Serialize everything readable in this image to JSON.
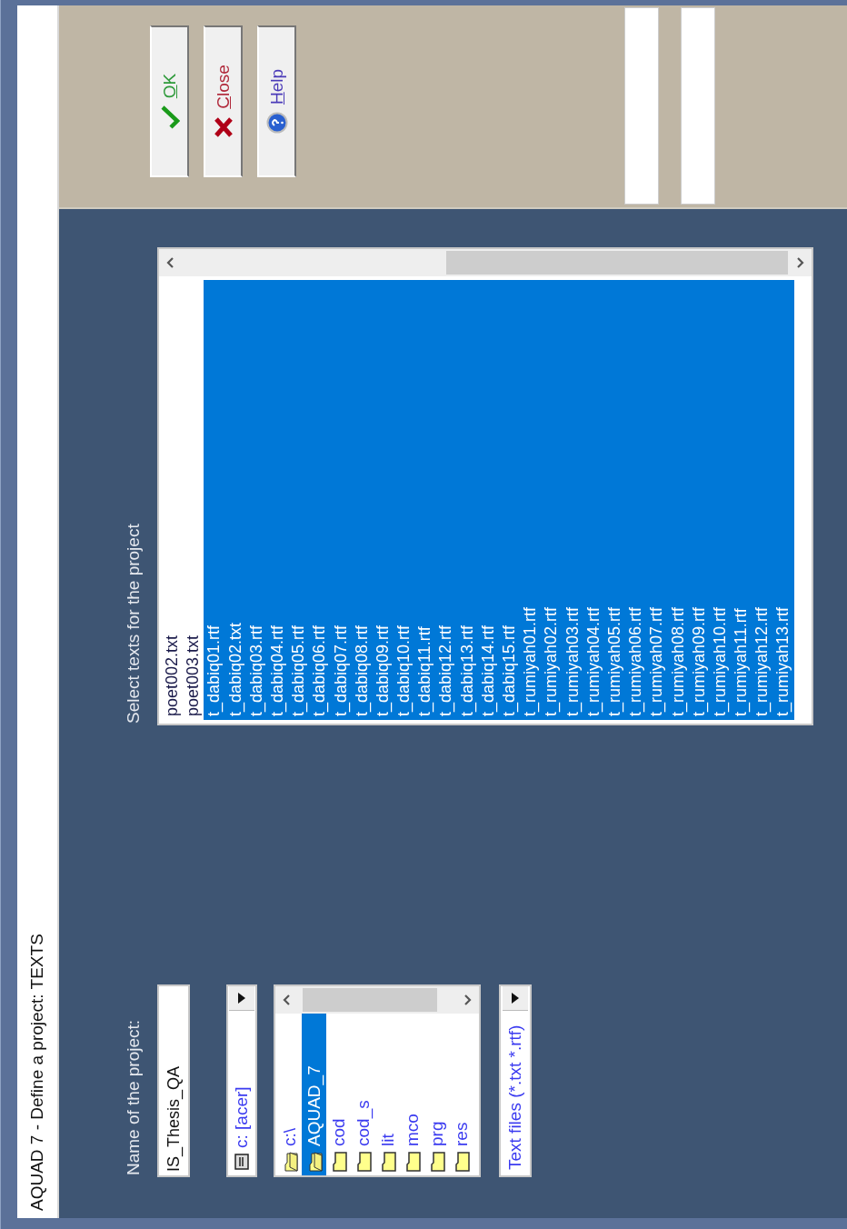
{
  "window": {
    "title": "AQUAD 7 - Define a project: TEXTS"
  },
  "project_name": {
    "label": "Name of the project:",
    "value": "IS_Thesis_QA"
  },
  "drive": {
    "value": "c: [acer]"
  },
  "folders": [
    {
      "name": "c:\\",
      "kind": "open",
      "selected": false
    },
    {
      "name": "AQUAD_7",
      "kind": "open",
      "selected": true
    },
    {
      "name": "cod",
      "kind": "closed",
      "selected": false
    },
    {
      "name": "cod_s",
      "kind": "closed",
      "selected": false
    },
    {
      "name": "lit",
      "kind": "closed",
      "selected": false
    },
    {
      "name": "mco",
      "kind": "closed",
      "selected": false
    },
    {
      "name": "prg",
      "kind": "closed",
      "selected": false
    },
    {
      "name": "res",
      "kind": "closed",
      "selected": false
    }
  ],
  "filter": {
    "value": "Text files (*.txt  *.rtf)"
  },
  "texts": {
    "label": "Select texts for the project",
    "items": [
      {
        "name": "poet002.txt",
        "selected": false
      },
      {
        "name": "poet003.txt",
        "selected": false
      },
      {
        "name": "t_dabiq01.rtf",
        "selected": true
      },
      {
        "name": "t_dabiq02.txt",
        "selected": true
      },
      {
        "name": "t_dabiq03.rtf",
        "selected": true
      },
      {
        "name": "t_dabiq04.rtf",
        "selected": true
      },
      {
        "name": "t_dabiq05.rtf",
        "selected": true
      },
      {
        "name": "t_dabiq06.rtf",
        "selected": true
      },
      {
        "name": "t_dabiq07.rtf",
        "selected": true
      },
      {
        "name": "t_dabiq08.rtf",
        "selected": true
      },
      {
        "name": "t_dabiq09.rtf",
        "selected": true
      },
      {
        "name": "t_dabiq10.rtf",
        "selected": true
      },
      {
        "name": "t_dabiq11.rtf",
        "selected": true
      },
      {
        "name": "t_dabiq12.rtf",
        "selected": true
      },
      {
        "name": "t_dabiq13.rtf",
        "selected": true
      },
      {
        "name": "t_dabiq14.rtf",
        "selected": true
      },
      {
        "name": "t_dabiq15.rtf",
        "selected": true
      },
      {
        "name": "t_rumiyah01.rtf",
        "selected": true
      },
      {
        "name": "t_rumiyah02.rtf",
        "selected": true
      },
      {
        "name": "t_rumiyah03.rtf",
        "selected": true
      },
      {
        "name": "t_rumiyah04.rtf",
        "selected": true
      },
      {
        "name": "t_rumiyah05.rtf",
        "selected": true
      },
      {
        "name": "t_rumiyah06.rtf",
        "selected": true
      },
      {
        "name": "t_rumiyah07.rtf",
        "selected": true
      },
      {
        "name": "t_rumiyah08.rtf",
        "selected": true
      },
      {
        "name": "t_rumiyah09.rtf",
        "selected": true
      },
      {
        "name": "t_rumiyah10.rtf",
        "selected": true
      },
      {
        "name": "t_rumiyah11.rtf",
        "selected": true
      },
      {
        "name": "t_rumiyah12.rtf",
        "selected": true
      },
      {
        "name": "t_rumiyah13.rtf",
        "selected": true
      }
    ]
  },
  "buttons": [
    {
      "label": "OK",
      "kind": "ok",
      "color": "#2e9a3a"
    },
    {
      "label": "Close",
      "kind": "close",
      "color": "#b0283a"
    },
    {
      "label": "Help",
      "kind": "help",
      "color": "#4a3ab8"
    }
  ]
}
